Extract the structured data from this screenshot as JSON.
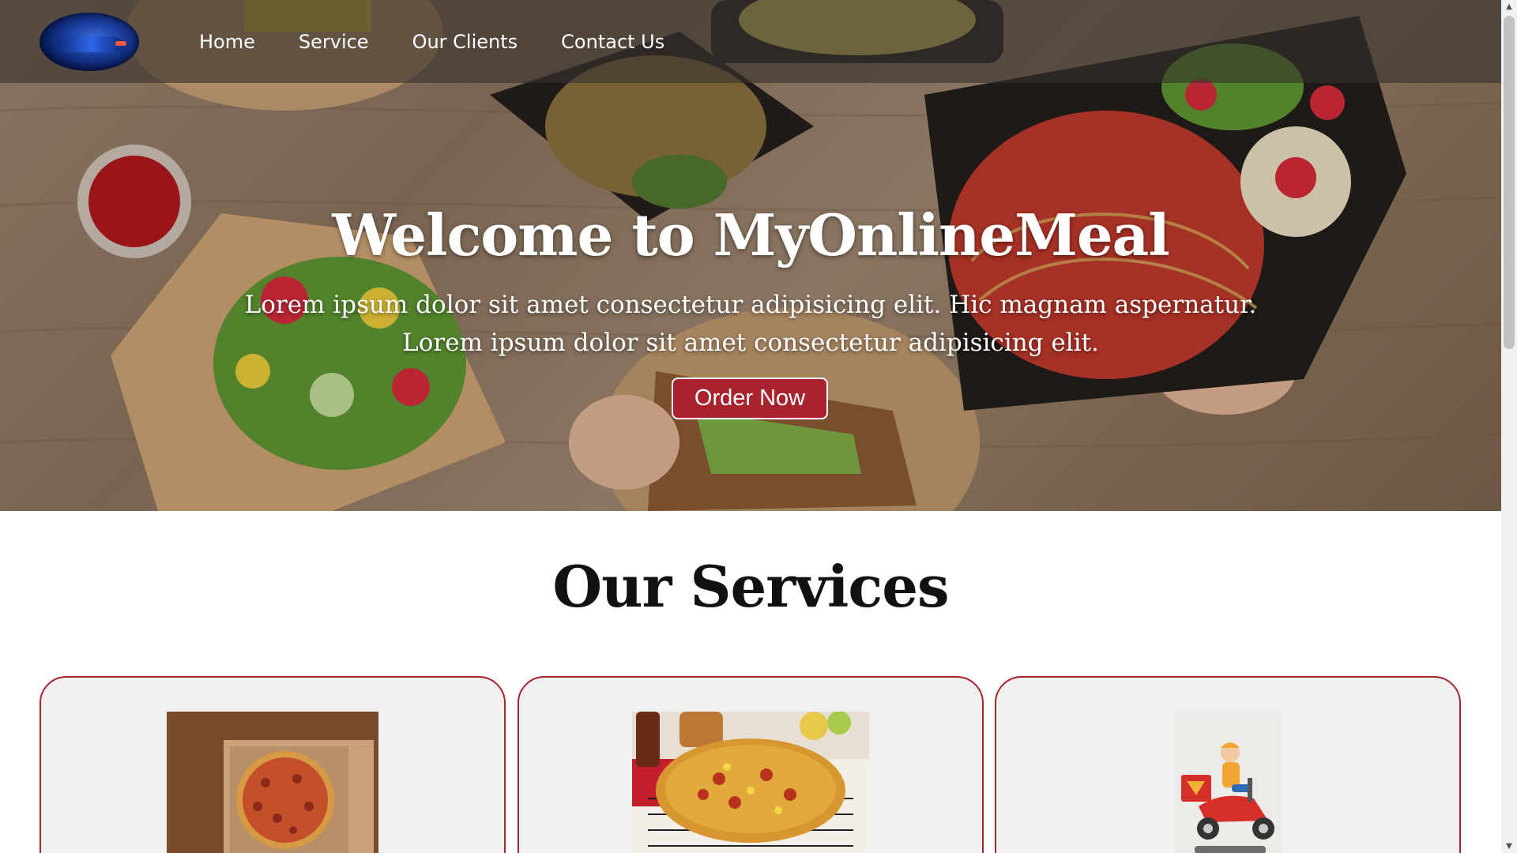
{
  "nav": {
    "logo": "car-logo",
    "links": [
      "Home",
      "Service",
      "Our Clients",
      "Contact Us"
    ]
  },
  "hero": {
    "title": "Welcome to MyOnlineMeal",
    "subtitle_line1": "Lorem ipsum dolor sit amet consectetur adipisicing elit. Hic magnam aspernatur.",
    "subtitle_line2": "Lorem ipsum dolor sit amet consectetur adipisicing elit.",
    "cta_label": "Order Now"
  },
  "services": {
    "title": "Our Services",
    "cards": [
      {
        "image": "pizza-in-box"
      },
      {
        "image": "pizza-on-rack"
      },
      {
        "image": "delivery-scooter"
      }
    ]
  },
  "colors": {
    "accent": "#a8232d",
    "card_bg": "#f1f0f0",
    "nav_bg": "rgba(55,50,45,0.62)"
  }
}
